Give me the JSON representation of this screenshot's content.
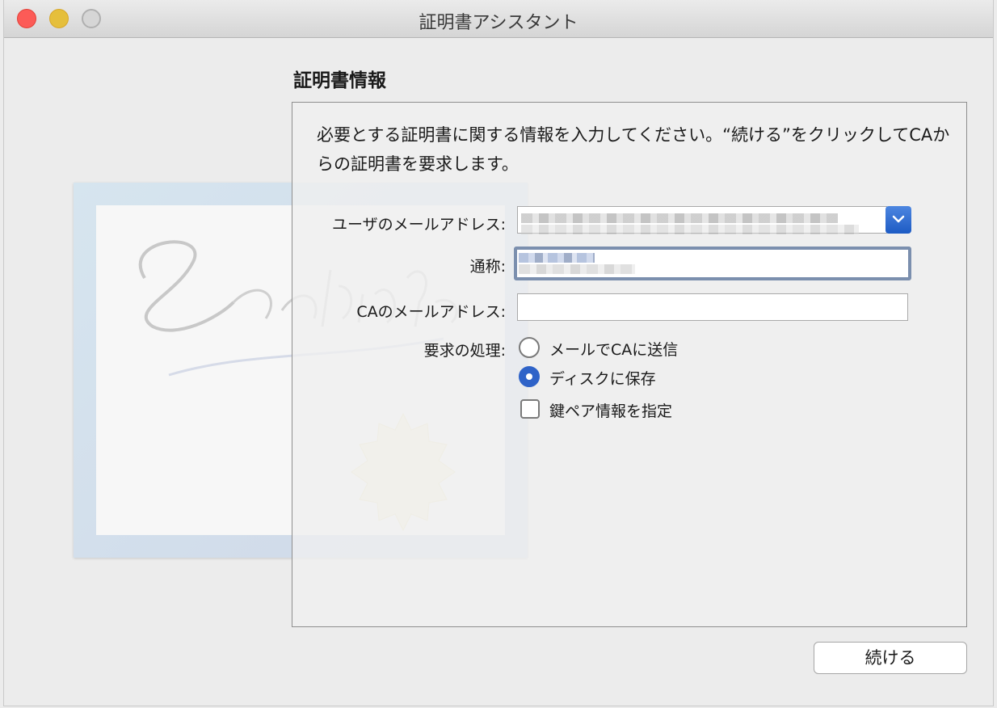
{
  "window": {
    "title": "証明書アシスタント"
  },
  "section": {
    "title": "証明書情報",
    "description": "必要とする証明書に関する情報を入力してください。“続ける”をクリックしてCAからの証明書を要求します。"
  },
  "form": {
    "user_email": {
      "label": "ユーザのメールアドレス:",
      "value": ""
    },
    "common_name": {
      "label": "通称:",
      "value": ""
    },
    "ca_email": {
      "label": "CAのメールアドレス:",
      "value": ""
    },
    "request": {
      "label": "要求の処理:",
      "options": [
        {
          "label": "メールでCAに送信",
          "selected": false
        },
        {
          "label": "ディスクに保存",
          "selected": true
        }
      ]
    },
    "keypair": {
      "label": "鍵ペア情報を指定",
      "checked": false
    }
  },
  "buttons": {
    "continue_label": "続ける"
  },
  "colors": {
    "accent": "#2f63c8",
    "close": "#fc5b57",
    "minimize": "#e5bf3c",
    "zoom": "#d6d6d6"
  }
}
